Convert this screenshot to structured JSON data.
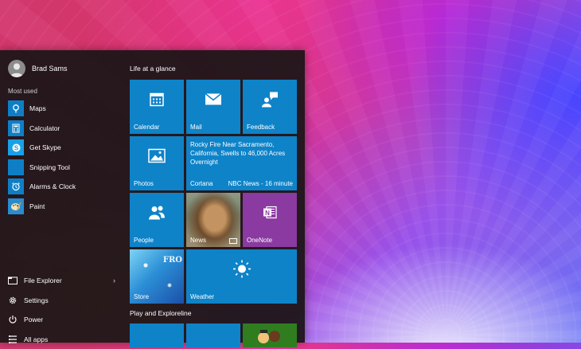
{
  "user": {
    "name": "Brad Sams"
  },
  "most_used": {
    "title": "Most used",
    "items": [
      {
        "label": "Maps",
        "icon": "maps-icon"
      },
      {
        "label": "Calculator",
        "icon": "calculator-icon"
      },
      {
        "label": "Get Skype",
        "icon": "skype-icon"
      },
      {
        "label": "Snipping Tool",
        "icon": "scissors-icon"
      },
      {
        "label": "Alarms & Clock",
        "icon": "alarm-icon"
      },
      {
        "label": "Paint",
        "icon": "paint-icon"
      }
    ]
  },
  "bottom": {
    "items": [
      {
        "label": "File Explorer",
        "icon": "folder-icon",
        "chevron": "›"
      },
      {
        "label": "Settings",
        "icon": "gear-icon"
      },
      {
        "label": "Power",
        "icon": "power-icon"
      },
      {
        "label": "All apps",
        "icon": "list-icon"
      }
    ]
  },
  "tiles": {
    "group1_title": "Life at a glance",
    "group2_title": "Play and Exploreline",
    "calendar": "Calendar",
    "mail": "Mail",
    "feedback": "Feedback",
    "photos": "Photos",
    "cortana": {
      "label": "Cortana",
      "headline": "Rocky Fire Near Sacramento, California, Swells to 46,000 Acres Overnight",
      "source": "NBC News - 16 minute"
    },
    "people": "People",
    "news": "News",
    "onenote": "OneNote",
    "store": "Store",
    "store_art_text": "FRO",
    "weather": "Weather"
  },
  "colors": {
    "tile_blue": "#0e83c8",
    "onenote_purple": "#8a3aa0",
    "menu_bg": "#1c1618"
  }
}
